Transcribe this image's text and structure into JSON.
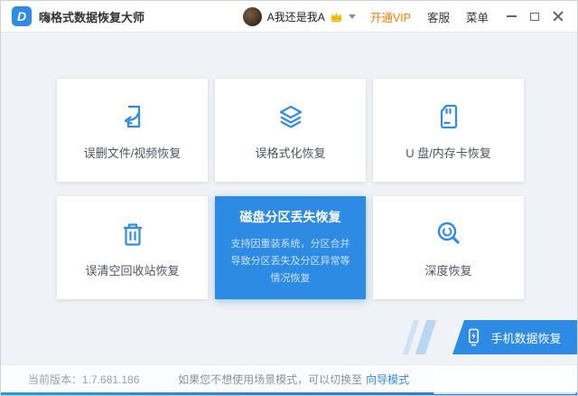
{
  "app": {
    "title": "嗨格式数据恢复大师"
  },
  "titlebar": {
    "username": "A我还是我A",
    "vip_label": "开通VIP",
    "service_label": "客服",
    "menu_label": "菜单"
  },
  "cards": [
    {
      "label": "误删文件/视频恢复",
      "icon": "file-restore-icon"
    },
    {
      "label": "误格式化恢复",
      "icon": "layers-icon"
    },
    {
      "label": "U 盘/内存卡恢复",
      "icon": "sd-card-icon"
    },
    {
      "label": "误清空回收站恢复",
      "icon": "trash-icon"
    },
    {
      "label": "磁盘分区丢失恢复",
      "desc": "支持因重装系统，分区合并导致分区丢失及分区异常等情况恢复",
      "highlighted": true
    },
    {
      "label": "深度恢复",
      "icon": "deep-scan-icon"
    }
  ],
  "phone_banner": {
    "label": "手机数据恢复",
    "icon": "phone-icon"
  },
  "footer": {
    "version_label": "当前版本：",
    "version": "1.7.681.186",
    "hint_text": "如果您不想使用场景模式，可以切换至",
    "link_label": "向导模式"
  },
  "colors": {
    "accent": "#2f8ce6",
    "highlight": "#2e8be4",
    "vip_orange": "#ff7e00"
  }
}
